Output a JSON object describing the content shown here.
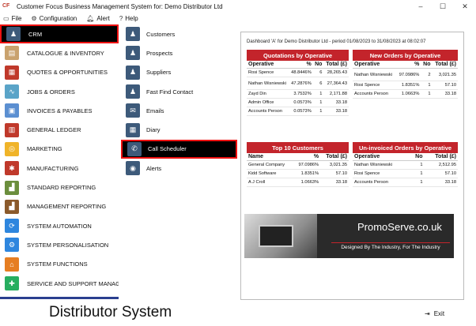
{
  "titlebar": {
    "logo": "CF",
    "title": "Customer Focus Business Management System for: Demo Distributor Ltd",
    "minimize": "–",
    "maximize": "☐",
    "close": "✕"
  },
  "menubar": {
    "items": [
      {
        "icon": "file-icon",
        "label": "File"
      },
      {
        "icon": "gear-icon",
        "label": "Configuration"
      },
      {
        "icon": "bell-icon",
        "label": "Alert"
      },
      {
        "icon": "help-icon",
        "label": "Help"
      }
    ]
  },
  "leftnav": {
    "items": [
      {
        "label": "CRM",
        "color": "#3d5a7a",
        "glyph": "♟"
      },
      {
        "label": "CATALOGUE & INVENTORY",
        "color": "#c9a26e",
        "glyph": "▤"
      },
      {
        "label": "QUOTES & OPPORTUNITIES",
        "color": "#c0392b",
        "glyph": "▦"
      },
      {
        "label": "JOBS & ORDERS",
        "color": "#5aa4c8",
        "glyph": "∿"
      },
      {
        "label": "INVOICES & PAYABLES",
        "color": "#5b8fd1",
        "glyph": "▣"
      },
      {
        "label": "GENERAL LEDGER",
        "color": "#c0392b",
        "glyph": "▥"
      },
      {
        "label": "MARKETING",
        "color": "#f0b429",
        "glyph": "◎"
      },
      {
        "label": "MANUFACTURING",
        "color": "#c0392b",
        "glyph": "✱"
      },
      {
        "label": "STANDARD REPORTING",
        "color": "#6b8e3d",
        "glyph": "▟"
      },
      {
        "label": "MANAGEMENT REPORTING",
        "color": "#8b5a2b",
        "glyph": "▟"
      },
      {
        "label": "SYSTEM AUTOMATION",
        "color": "#2e86de",
        "glyph": "⟳"
      },
      {
        "label": "SYSTEM PERSONALISATION",
        "color": "#2e86de",
        "glyph": "⚙"
      },
      {
        "label": "SYSTEM FUNCTIONS",
        "color": "#e67e22",
        "glyph": "⌂"
      },
      {
        "label": "SERVICE AND SUPPORT MANAGE",
        "color": "#27ae60",
        "glyph": "✚"
      }
    ]
  },
  "subnav": {
    "items": [
      {
        "label": "Customers",
        "glyph": "♟"
      },
      {
        "label": "Prospects",
        "glyph": "♟"
      },
      {
        "label": "Suppliers",
        "glyph": "♟"
      },
      {
        "label": "Fast Find Contact",
        "glyph": "♟"
      },
      {
        "label": "Emails",
        "glyph": "✉"
      },
      {
        "label": "Diary",
        "glyph": "▦"
      },
      {
        "label": "Call Scheduler",
        "glyph": "✆"
      },
      {
        "label": "Alerts",
        "glyph": "◉"
      }
    ]
  },
  "dashboard": {
    "title": "Dashboard 'A' for Demo Distributor Ltd - period 01/08/2023 to 31/08/2023 at 08:02:07",
    "quotations": {
      "heading": "Quotations by Operative",
      "columns": [
        "Operative",
        "%",
        "No",
        "Total (£)"
      ],
      "rows": [
        [
          "Rosi Spence",
          "48.8446%",
          "6",
          "28,265.43"
        ],
        [
          "Nathan Wisniewski",
          "47.2876%",
          "6",
          "27,364.43"
        ],
        [
          "Zayd Din",
          "3.7532%",
          "1",
          "2,171.88"
        ],
        [
          "Admin Office",
          "0.0573%",
          "1",
          "33.18"
        ],
        [
          "Accounts Person",
          "0.0573%",
          "1",
          "33.18"
        ]
      ]
    },
    "new_orders": {
      "heading": "New Orders by Operative",
      "columns": [
        "Operative",
        "%",
        "No",
        "Total (£)"
      ],
      "rows": [
        [
          "Nathan Wisniewski",
          "97.0986%",
          "2",
          "3,021.35"
        ],
        [
          "Rosi Spence",
          "1.8351%",
          "1",
          "57.10"
        ],
        [
          "Accounts Person",
          "1.0663%",
          "1",
          "33.18"
        ]
      ]
    },
    "top_customers": {
      "heading": "Top 10 Customers",
      "columns": [
        "Name",
        "%",
        "Total (£)"
      ],
      "rows": [
        [
          "General Company",
          "97.0986%",
          "3,021.35"
        ],
        [
          "Kidd Software",
          "1.8351%",
          "57.10"
        ],
        [
          "A J Croll",
          "1.0663%",
          "33.18"
        ]
      ]
    },
    "uninvoiced": {
      "heading": "Un-invoiced Orders by Operative",
      "columns": [
        "Operative",
        "No",
        "Total (£)"
      ],
      "rows": [
        [
          "Nathan Wisniewski",
          "1",
          "2,512.95"
        ],
        [
          "Rosi Spence",
          "1",
          "57.10"
        ],
        [
          "Accounts Person",
          "1",
          "33.18"
        ]
      ]
    },
    "promo": {
      "name": "PromoServe.co.uk",
      "tagline": "Designed By The Industry, For The Industry"
    }
  },
  "footer": {
    "title": "Distributor System",
    "exit_label": "Exit"
  }
}
